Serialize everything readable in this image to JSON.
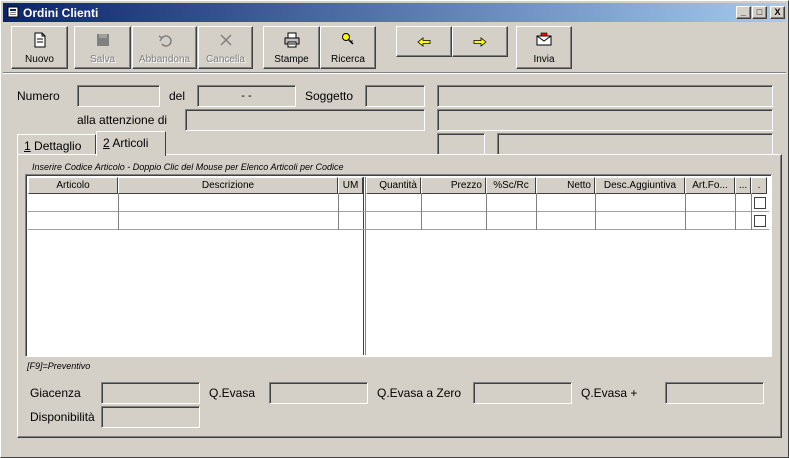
{
  "window": {
    "title": "Ordini Clienti",
    "controls": {
      "minimize": "_",
      "maximize": "□",
      "close": "X"
    }
  },
  "toolbar": {
    "nuovo": "Nuovo",
    "salva": "Salva",
    "abbandona": "Abbandona",
    "cancella": "Cancella",
    "stampe": "Stampe",
    "ricerca": "Ricerca",
    "invia": "Invia"
  },
  "header": {
    "numero_label": "Numero",
    "numero_value": "",
    "del_label": "del",
    "del_value": "  -  -",
    "soggetto_label": "Soggetto",
    "soggetto_value": "",
    "attenzione_label": "alla attenzione di",
    "attenzione_value": ""
  },
  "tabs": [
    {
      "key": "1",
      "label": " Dettaglio"
    },
    {
      "key": "2",
      "label": " Articoli"
    }
  ],
  "articoli": {
    "hint": "Inserire Codice Articolo - Doppio Clic del Mouse per Elenco Articoli per Codice",
    "columns": {
      "articolo": "Articolo",
      "descrizione": "Descrizione",
      "um": "UM",
      "quantita": "Quantità",
      "prezzo": "Prezzo",
      "sconto": "%Sc/Rc",
      "netto": "Netto",
      "desc_agg": "Desc.Aggiuntiva",
      "art_fo": "Art.Fo...",
      "more": "...",
      "flag": "."
    },
    "footnote": "[F9]=Preventivo"
  },
  "footer": {
    "giacenza_label": "Giacenza",
    "qevasa_label": "Q.Evasa",
    "qevasa_zero_label": "Q.Evasa a Zero",
    "qevasa_plus_label": "Q.Evasa +",
    "disponibilita_label": "Disponibilità"
  },
  "icons": {
    "nuovo": "new-document-icon",
    "salva": "save-icon",
    "abbandona": "undo-icon",
    "cancella": "delete-icon",
    "stampe": "printer-icon",
    "ricerca": "search-key-icon",
    "prev": "arrow-left-icon",
    "next": "arrow-right-icon",
    "invia": "send-icon"
  },
  "colors": {
    "face": "#d4d0c8",
    "title_start": "#0a246a",
    "title_end": "#a6caf0"
  }
}
